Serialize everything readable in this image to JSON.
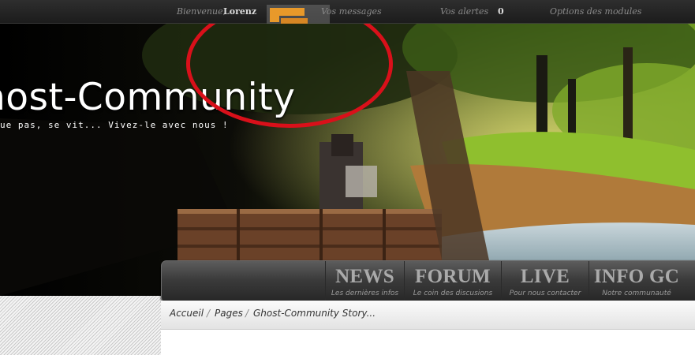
{
  "topbar": {
    "welcome_text": "Bienvenue,",
    "username": "Lorenz",
    "messages_label": "Vos messages",
    "alerts_label": "Vos alertes",
    "alerts_count": "0",
    "options_label": "Options des modules"
  },
  "banner": {
    "title": "host-Community",
    "tagline": "ue pas, se vit... Vivez-le avec nous !"
  },
  "nav": {
    "items": [
      {
        "label": "NEWS",
        "sub": "Les dernières infos"
      },
      {
        "label": "FORUM",
        "sub": "Le coin des discusions"
      },
      {
        "label": "LIVE",
        "sub": "Pour nous contacter"
      },
      {
        "label": "INFO GC",
        "sub": "Notre communauté"
      }
    ]
  },
  "breadcrumb": {
    "items": [
      "Accueil",
      "Pages",
      "Ghost-Community Story..."
    ],
    "separator": "/"
  },
  "colors": {
    "topbar_bg": "#232323",
    "annotation_circle": "#d9101a",
    "nav_text": "#aaaaaa",
    "message_bubble": "#e8992a"
  }
}
